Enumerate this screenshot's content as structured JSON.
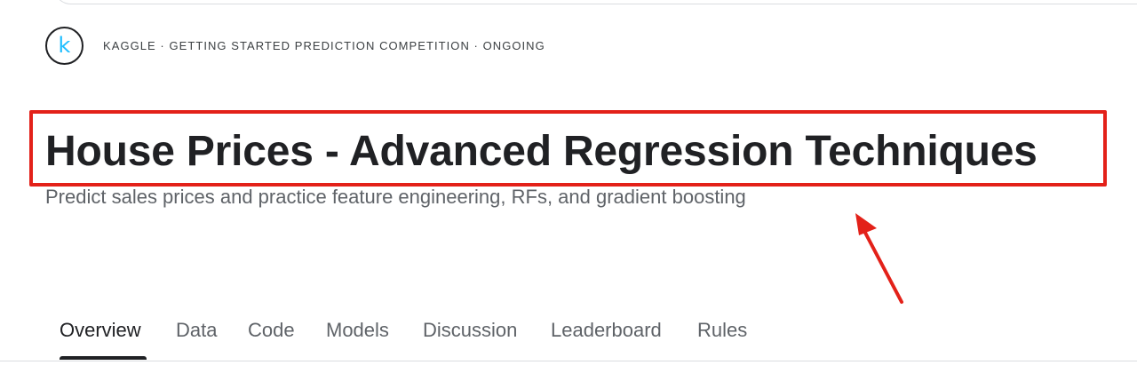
{
  "header": {
    "logo_letter": "k",
    "breadcrumb": "KAGGLE · GETTING STARTED PREDICTION COMPETITION · ONGOING"
  },
  "competition": {
    "title": "House Prices - Advanced Regression Techniques",
    "subtitle": "Predict sales prices and practice feature engineering, RFs, and gradient boosting"
  },
  "tabs": [
    {
      "label": "Overview",
      "active": true
    },
    {
      "label": "Data",
      "active": false
    },
    {
      "label": "Code",
      "active": false
    },
    {
      "label": "Models",
      "active": false
    },
    {
      "label": "Discussion",
      "active": false
    },
    {
      "label": "Leaderboard",
      "active": false
    },
    {
      "label": "Rules",
      "active": false
    }
  ],
  "colors": {
    "brand_accent": "#20beff",
    "annotation_red": "#e32119",
    "text_primary": "#202124",
    "text_secondary": "#5f6368"
  },
  "icons": {
    "logo": "kaggle-k-logo-icon",
    "annotation": "red-arrow-icon"
  }
}
